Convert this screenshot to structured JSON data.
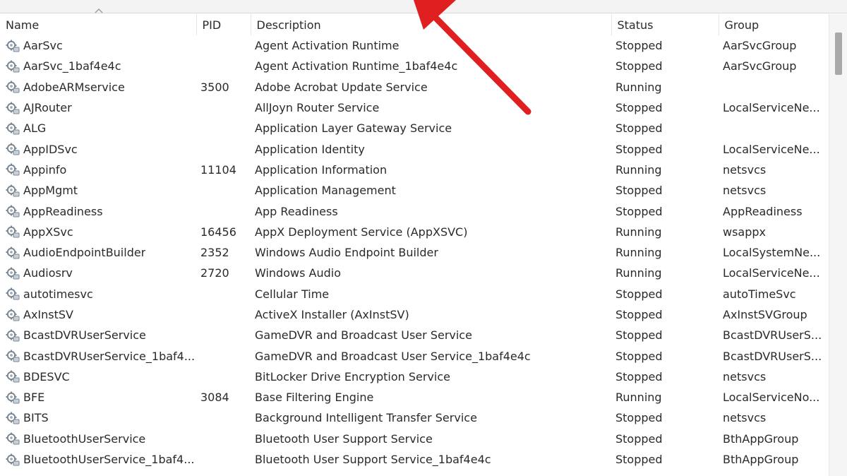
{
  "columns": {
    "name": "Name",
    "pid": "PID",
    "description": "Description",
    "status": "Status",
    "group": "Group"
  },
  "rows": [
    {
      "name": "AarSvc",
      "pid": "",
      "description": "Agent Activation Runtime",
      "status": "Stopped",
      "group": "AarSvcGroup"
    },
    {
      "name": "AarSvc_1baf4e4c",
      "pid": "",
      "description": "Agent Activation Runtime_1baf4e4c",
      "status": "Stopped",
      "group": "AarSvcGroup"
    },
    {
      "name": "AdobeARMservice",
      "pid": "3500",
      "description": "Adobe Acrobat Update Service",
      "status": "Running",
      "group": ""
    },
    {
      "name": "AJRouter",
      "pid": "",
      "description": "AllJoyn Router Service",
      "status": "Stopped",
      "group": "LocalServiceNe..."
    },
    {
      "name": "ALG",
      "pid": "",
      "description": "Application Layer Gateway Service",
      "status": "Stopped",
      "group": ""
    },
    {
      "name": "AppIDSvc",
      "pid": "",
      "description": "Application Identity",
      "status": "Stopped",
      "group": "LocalServiceNe..."
    },
    {
      "name": "Appinfo",
      "pid": "11104",
      "description": "Application Information",
      "status": "Running",
      "group": "netsvcs"
    },
    {
      "name": "AppMgmt",
      "pid": "",
      "description": "Application Management",
      "status": "Stopped",
      "group": "netsvcs"
    },
    {
      "name": "AppReadiness",
      "pid": "",
      "description": "App Readiness",
      "status": "Stopped",
      "group": "AppReadiness"
    },
    {
      "name": "AppXSvc",
      "pid": "16456",
      "description": "AppX Deployment Service (AppXSVC)",
      "status": "Running",
      "group": "wsappx"
    },
    {
      "name": "AudioEndpointBuilder",
      "pid": "2352",
      "description": "Windows Audio Endpoint Builder",
      "status": "Running",
      "group": "LocalSystemNe..."
    },
    {
      "name": "Audiosrv",
      "pid": "2720",
      "description": "Windows Audio",
      "status": "Running",
      "group": "LocalServiceNe..."
    },
    {
      "name": "autotimesvc",
      "pid": "",
      "description": "Cellular Time",
      "status": "Stopped",
      "group": "autoTimeSvc"
    },
    {
      "name": "AxInstSV",
      "pid": "",
      "description": "ActiveX Installer (AxInstSV)",
      "status": "Stopped",
      "group": "AxInstSVGroup"
    },
    {
      "name": "BcastDVRUserService",
      "pid": "",
      "description": "GameDVR and Broadcast User Service",
      "status": "Stopped",
      "group": "BcastDVRUserS..."
    },
    {
      "name": "BcastDVRUserService_1baf4...",
      "pid": "",
      "description": "GameDVR and Broadcast User Service_1baf4e4c",
      "status": "Stopped",
      "group": "BcastDVRUserS..."
    },
    {
      "name": "BDESVC",
      "pid": "",
      "description": "BitLocker Drive Encryption Service",
      "status": "Stopped",
      "group": "netsvcs"
    },
    {
      "name": "BFE",
      "pid": "3084",
      "description": "Base Filtering Engine",
      "status": "Running",
      "group": "LocalServiceNo..."
    },
    {
      "name": "BITS",
      "pid": "",
      "description": "Background Intelligent Transfer Service",
      "status": "Stopped",
      "group": "netsvcs"
    },
    {
      "name": "BluetoothUserService",
      "pid": "",
      "description": "Bluetooth User Support Service",
      "status": "Stopped",
      "group": "BthAppGroup"
    },
    {
      "name": "BluetoothUserService_1baf4...",
      "pid": "",
      "description": "Bluetooth User Support Service_1baf4e4c",
      "status": "Stopped",
      "group": "BthAppGroup"
    }
  ],
  "icons": {
    "row_icon": "service-gear-icon",
    "sort_indicator": "sort-ascending-icon",
    "annotation": "red-arrow-icon"
  },
  "colors": {
    "annotation_arrow": "#e02020",
    "header_background": "#f3f3f3"
  }
}
